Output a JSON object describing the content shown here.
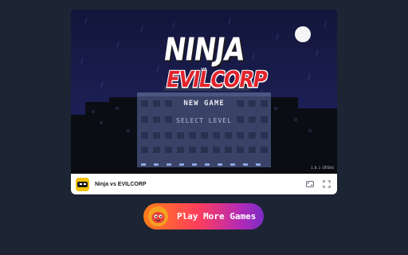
{
  "game": {
    "title_line1": "NINJA",
    "title_vs": "VS",
    "title_line2": "EVILCORP",
    "menu": {
      "new_game": "NEW GAME",
      "select_level": "SELECT LEVEL"
    },
    "version": "1.0.1 CRTEAS"
  },
  "info_bar": {
    "game_name": "Ninja vs EVILCORP",
    "fullscreen_icon": "fullscreen-icon",
    "expand_icon": "expand-icon"
  },
  "cta": {
    "label": "Play More Games",
    "icon": "mascot-icon"
  },
  "colors": {
    "page_background": "#1d2433",
    "title_red": "#e2232b",
    "cta_gradient_start": "#ff7d1a",
    "cta_gradient_end": "#7b2cc8"
  }
}
